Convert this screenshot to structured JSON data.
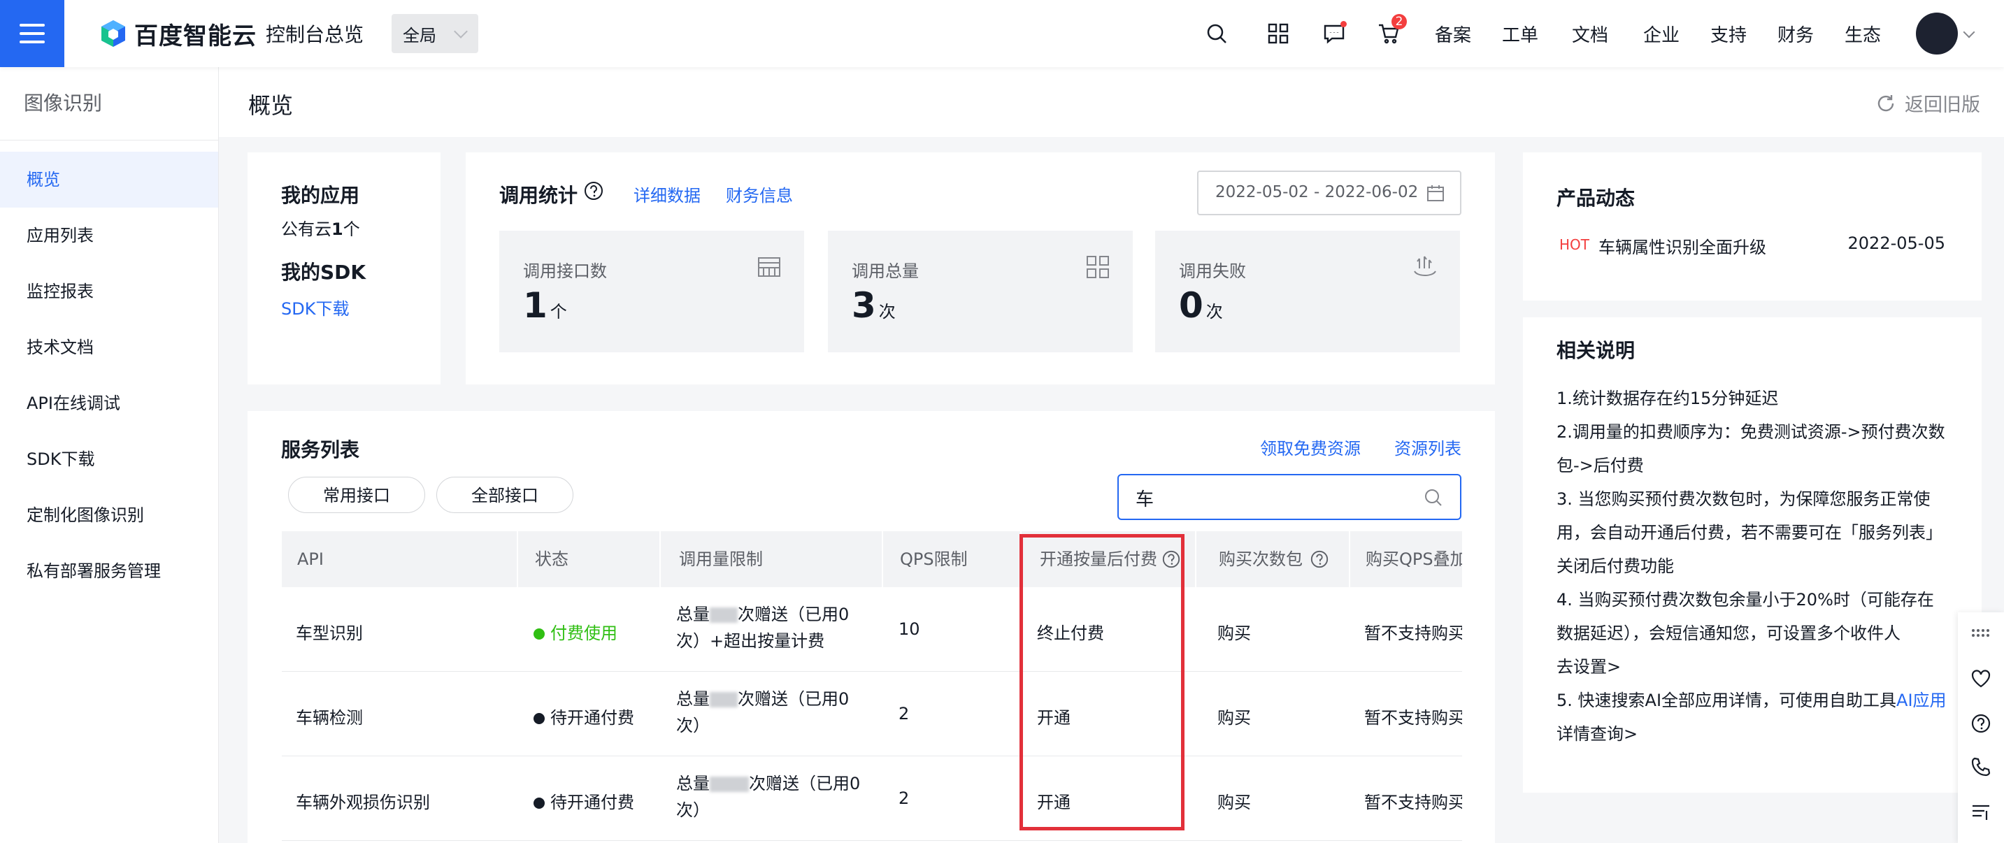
{
  "topbar": {
    "logo_text": "百度智能云",
    "console_title": "控制台总览",
    "region": "全局",
    "cart_count": "2",
    "nav": [
      "备案",
      "工单",
      "文档",
      "企业",
      "支持",
      "财务",
      "生态"
    ]
  },
  "sidebar": {
    "title": "图像识别",
    "items": [
      "概览",
      "应用列表",
      "监控报表",
      "技术文档",
      "API在线调试",
      "SDK下载",
      "定制化图像识别",
      "私有部署服务管理"
    ]
  },
  "page": {
    "title": "概览",
    "back_label": "返回旧版"
  },
  "my_app": {
    "title": "我的应用",
    "cloud_label": "公有云",
    "cloud_count": "1",
    "cloud_unit": "个",
    "sdk_title": "我的SDK",
    "sdk_link": "SDK下载"
  },
  "stats": {
    "title": "调用统计",
    "detail_link": "详细数据",
    "finance_link": "财务信息",
    "date_range": "2022-05-02 - 2022-06-02",
    "boxes": [
      {
        "label": "调用接口数",
        "value": "1",
        "unit": "个",
        "icon": "table-icon"
      },
      {
        "label": "调用总量",
        "value": "3",
        "unit": "次",
        "icon": "grid-icon"
      },
      {
        "label": "调用失败",
        "value": "0",
        "unit": "次",
        "icon": "failure-icon"
      }
    ]
  },
  "services": {
    "title": "服务列表",
    "free_link": "领取免费资源",
    "resource_link": "资源列表",
    "filter_common": "常用接口",
    "filter_all": "全部接口",
    "search_value": "车",
    "columns": [
      "API",
      "状态",
      "调用量限制",
      "QPS限制",
      "开通按量后付费",
      "购买次数包",
      "购买QPS叠加"
    ],
    "rows": [
      {
        "api": "车型识别",
        "status": "付费使用",
        "status_color": "#30bf13",
        "quota_a": "总量",
        "quota_b": "次赠送（已用0",
        "quota_c": "次）",
        "quota_d": "+超出按量计费",
        "qps": "10",
        "postpay": "终止付费",
        "buy": "购买",
        "buy_qps": "暂不支持购买"
      },
      {
        "api": "车辆检测",
        "status": "待开通付费",
        "status_color": "#151b26",
        "quota_a": "总量",
        "quota_b": "次赠送（已用0",
        "quota_c": "次）",
        "quota_d": "",
        "qps": "2",
        "postpay": "开通",
        "buy": "购买",
        "buy_qps": "暂不支持购买"
      },
      {
        "api": "车辆外观损伤识别",
        "status": "待开通付费",
        "status_color": "#151b26",
        "quota_a": "总量",
        "quota_b": "次赠送（已用0",
        "quota_c": "次）",
        "quota_d": "",
        "qps": "2",
        "postpay": "开通",
        "buy": "购买",
        "buy_qps": "暂不支持购买"
      }
    ]
  },
  "news": {
    "title": "产品动态",
    "tag": "HOT",
    "item": "车辆属性识别全面升级",
    "date": "2022-05-05"
  },
  "notes": {
    "title": "相关说明",
    "n1": "1.统计数据存在约15分钟延迟",
    "n2a": "2.调用量的扣费顺序为：免费测试资源->预付费次数",
    "n2b": "包->后付费",
    "n3a": "3. 当您购买预付费次数包时，为保障您服务正常使",
    "n3b": "用，会自动开通后付费，若不需要可在「服务列表」",
    "n3c": "关闭后付费功能",
    "n4a": "4. 当购买预付费次数包余量小于20%时（可能存在",
    "n4b": "数据延迟），会短信通知您，可设置多个收件人",
    "n4_link": "去设置>",
    "n5a": "5. 快速搜索AI全部应用详情，可使用自助工具",
    "n5_link_a": "AI应用",
    "n5_link_b": "详情查询>"
  }
}
